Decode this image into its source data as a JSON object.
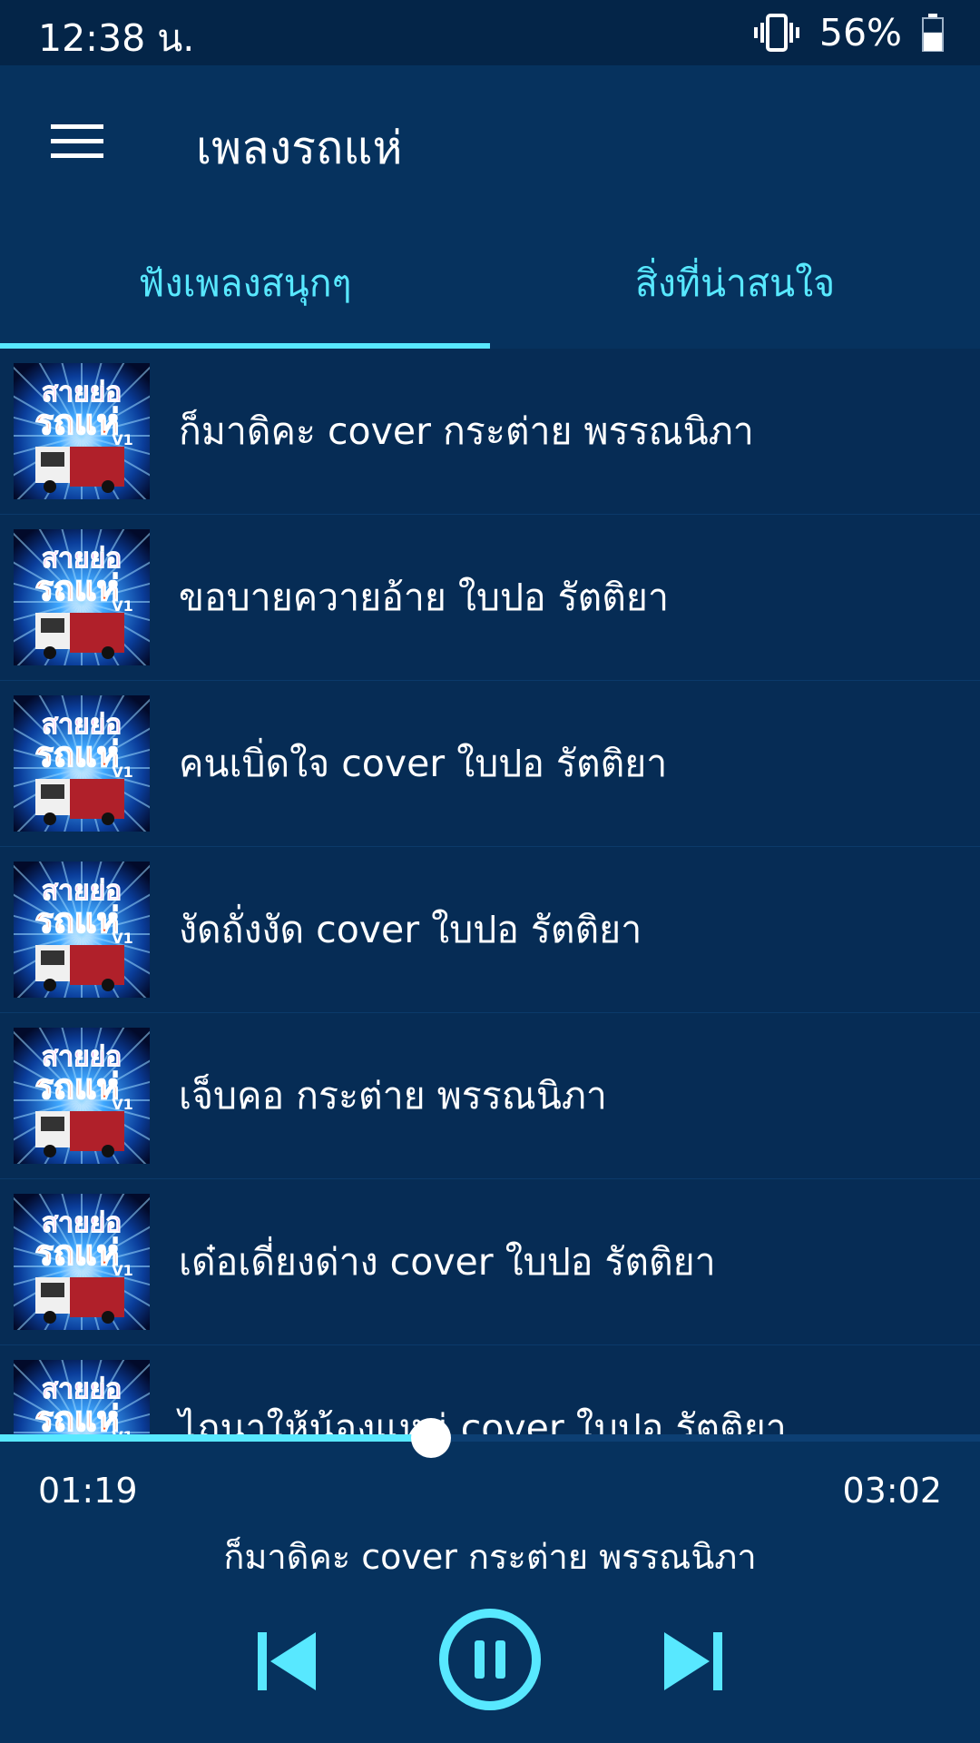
{
  "status": {
    "time": "12:38 น.",
    "battery_text": "56%",
    "battery_level": 0.56
  },
  "appbar": {
    "title": "เพลงรถแห่",
    "menu_icon": "menu-icon"
  },
  "tabs": [
    {
      "label": "ฟังเพลงสนุกๆ",
      "active": true
    },
    {
      "label": "สิ่งที่น่าสนใจ",
      "active": false
    }
  ],
  "thumb": {
    "line1": "สายย่อ",
    "line2": "รถแห่",
    "tag": "V1"
  },
  "songs": [
    {
      "title": "ก็มาดิคะ cover กระต่าย พรรณนิภา"
    },
    {
      "title": "ขอบายควายอ้าย ใบปอ รัตติยา"
    },
    {
      "title": "คนเบิ่ดใจ cover ใบปอ รัตติยา"
    },
    {
      "title": "งัดถั่งงัด cover ใบปอ รัตติยา"
    },
    {
      "title": "เจ็บคอ กระต่าย พรรณนิภา"
    },
    {
      "title": "เด๋อเดี่ยงด่าง cover ใบปอ รัตติยา"
    },
    {
      "title": "ไถนาให้น้องแหน่ cover ใบปอ รัตติยา"
    }
  ],
  "player": {
    "current_time": "01:19",
    "total_time": "03:02",
    "progress": 0.44,
    "now_playing": "ก็มาดิคะ cover กระต่าย พรรณนิภา",
    "prev_icon": "skip-previous-icon",
    "pause_icon": "pause-icon",
    "next_icon": "skip-next-icon"
  },
  "colors": {
    "accent": "#58e8ff",
    "background": "#062c55",
    "appbar": "#06325e"
  }
}
